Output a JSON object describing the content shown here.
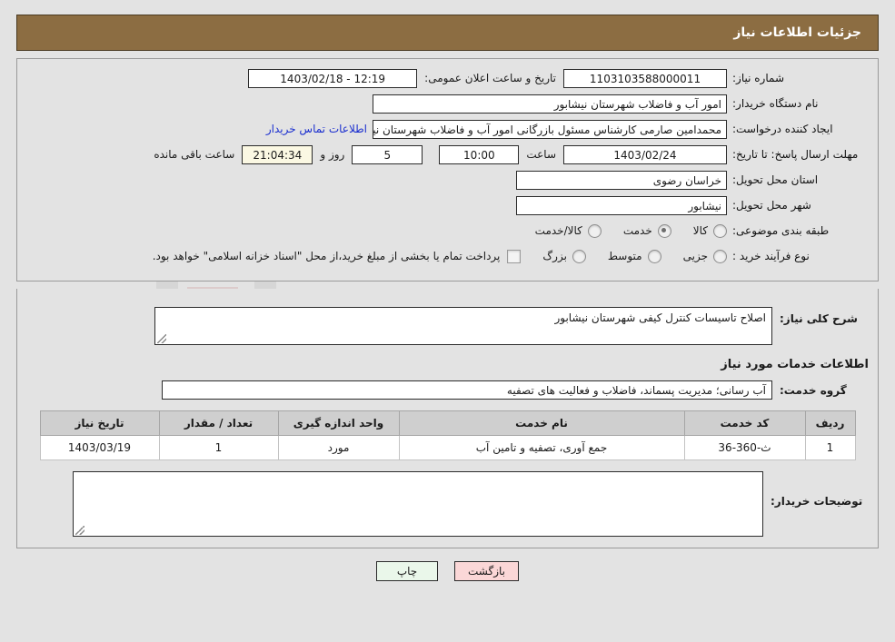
{
  "header": {
    "title": "جزئیات اطلاعات نیاز"
  },
  "watermark": {
    "text": "AriaTender.net"
  },
  "form": {
    "need_number_label": "شماره نیاز:",
    "need_number_value": "1103103588000011",
    "announce_label": "تاریخ و ساعت اعلان عمومی:",
    "announce_value": "12:19 - 1403/02/18",
    "buyer_org_label": "نام دستگاه خریدار:",
    "buyer_org_value": "امور آب و فاضلاب شهرستان نیشابور",
    "creator_label": "ایجاد کننده درخواست:",
    "creator_value": "محمدامین صارمی کارشناس مسئول بازرگانی امور آب و فاضلاب شهرستان نیشا",
    "contact_link": "اطلاعات تماس خریدار",
    "deadline_label": "مهلت ارسال پاسخ: تا تاریخ:",
    "deadline_date": "1403/02/24",
    "deadline_hour_label": "ساعت",
    "deadline_hour_value": "10:00",
    "days_value": "5",
    "days_label": "روز و",
    "countdown_value": "21:04:34",
    "countdown_label": "ساعت باقی مانده",
    "province_label": "استان محل تحویل:",
    "province_value": "خراسان رضوی",
    "city_label": "شهر محل تحویل:",
    "city_value": "نیشابور",
    "classification_label": "طبقه بندی موضوعی:",
    "classification_options": [
      {
        "label": "کالا",
        "selected": false
      },
      {
        "label": "خدمت",
        "selected": true
      },
      {
        "label": "کالا/خدمت",
        "selected": false
      }
    ],
    "process_label": "نوع فرآیند خرید :",
    "process_options": [
      {
        "label": "جزیی",
        "selected": false
      },
      {
        "label": "متوسط",
        "selected": false
      },
      {
        "label": "بزرگ",
        "selected": false
      }
    ],
    "treasury_checkbox_checked": false,
    "treasury_note": "پرداخت تمام یا بخشی از مبلغ خرید،از محل \"اسناد خزانه اسلامی\" خواهد بود."
  },
  "description": {
    "summary_label": "شرح کلی نیاز:",
    "summary_value": "اصلاح تاسیسات کنترل کیفی شهرستان نیشابور",
    "section_title": "اطلاعات خدمات مورد نیاز",
    "group_label": "گروه خدمت:",
    "group_value": "آب رسانی؛ مدیریت پسماند، فاضلاب و فعالیت های تصفیه"
  },
  "table": {
    "columns": [
      "ردیف",
      "کد خدمت",
      "نام خدمت",
      "واحد اندازه گیری",
      "تعداد / مقدار",
      "تاریخ نیاز"
    ],
    "rows": [
      {
        "index": "1",
        "code": "ث-360-36",
        "name": "جمع آوری، تصفیه و تامین آب",
        "unit": "مورد",
        "qty": "1",
        "date": "1403/03/19"
      }
    ]
  },
  "notes": {
    "label": "توضیحات خریدار:",
    "value": ""
  },
  "buttons": {
    "print": "چاپ",
    "back": "بازگشت"
  },
  "colors": {
    "header_brown": "#8c6d42",
    "link_blue": "#1a2ecf",
    "print_green": "#eaf7ea",
    "back_pink": "#fbd7d7",
    "countdown_cream": "#fbf8e3"
  }
}
